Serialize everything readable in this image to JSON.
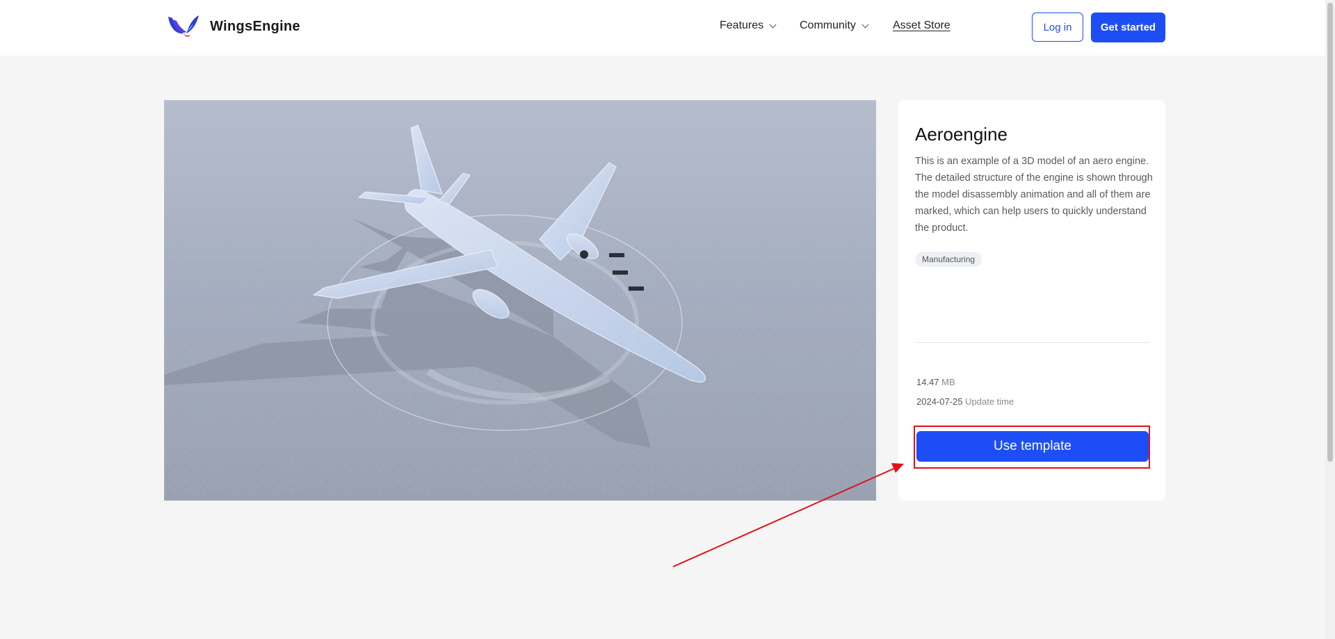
{
  "header": {
    "brand": "WingsEngine",
    "nav": {
      "features": "Features",
      "community": "Community",
      "asset_store": "Asset Store"
    },
    "login": "Log in",
    "get_started": "Get started"
  },
  "asset": {
    "title": "Aeroengine",
    "description": "This is an example of a 3D model of an aero engine. The detailed structure of the engine is shown through the model disassembly animation and all of them are marked, which can help users to quickly understand the product.",
    "tag": "Manufacturing",
    "size_value": "14.47",
    "size_unit": "MB",
    "date_value": "2024-07-25",
    "date_label": "Update time",
    "use_button": "Use template"
  },
  "colors": {
    "accent": "#1d4ef5",
    "annotation": "#e0101a"
  },
  "icons": {
    "logo": "wings-logo-icon",
    "dropdown": "chevron-down-icon"
  }
}
